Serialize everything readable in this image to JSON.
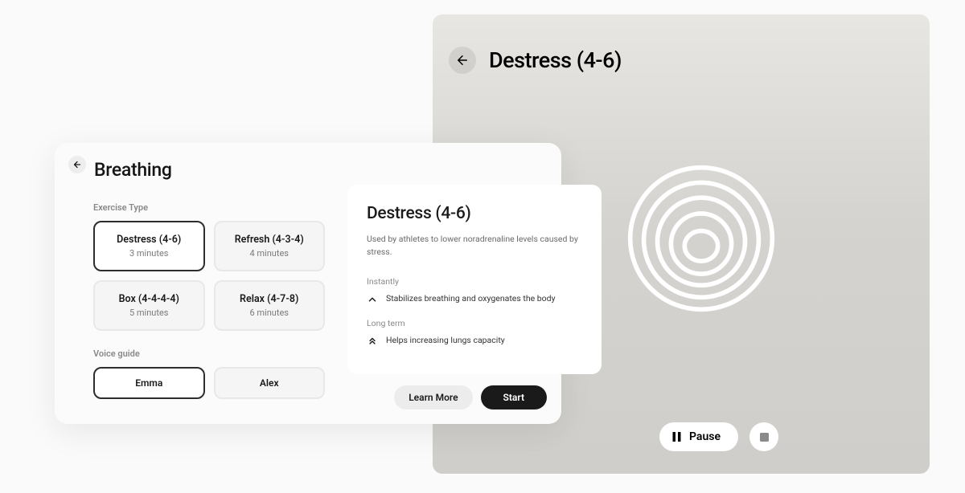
{
  "right": {
    "title": "Destress (4-6)",
    "pause_label": "Pause"
  },
  "card": {
    "title": "Breathing",
    "exercise_type_label": "Exercise Type",
    "voice_guide_label": "Voice guide",
    "exercises": [
      {
        "name": "Destress (4-6)",
        "duration": "3 minutes"
      },
      {
        "name": "Refresh (4-3-4)",
        "duration": "4 minutes"
      },
      {
        "name": "Box (4-4-4-4)",
        "duration": "5 minutes"
      },
      {
        "name": "Relax (4-7-8)",
        "duration": "6 minutes"
      }
    ],
    "voices": [
      "Emma",
      "Alex"
    ]
  },
  "detail": {
    "title": "Destress (4-6)",
    "description": "Used by athletes to lower noradrenaline levels caused by stress.",
    "instantly_label": "Instantly",
    "instantly_text": "Stabilizes breathing and oxygenates the body",
    "longterm_label": "Long term",
    "longterm_text": "Helps increasing lungs capacity"
  },
  "actions": {
    "learn_more": "Learn More",
    "start": "Start"
  }
}
